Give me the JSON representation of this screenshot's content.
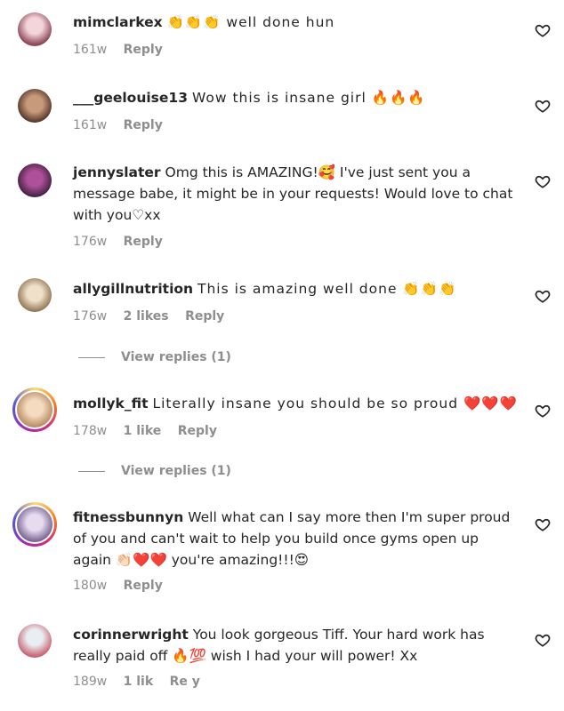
{
  "comments": [
    {
      "username": "mimclarkex",
      "text": "👏👏👏 well done hun",
      "age": "161w",
      "likes": "",
      "reply_label": "Reply",
      "avatar_colors": [
        "#c9a3ae",
        "#8f4a5a"
      ]
    },
    {
      "username": "___geelouise13",
      "text": "Wow this is insane girl 🔥🔥🔥",
      "age": "161w",
      "likes": "",
      "reply_label": "Reply",
      "avatar_colors": [
        "#5a3b2e",
        "#c89a7b"
      ]
    },
    {
      "username": "jennyslater",
      "text": "Omg this is AMAZING!🥰 I've just sent you a message babe, it might be in your requests! Would love to chat with you♡xx",
      "age": "176w",
      "likes": "",
      "reply_label": "Reply",
      "avatar_colors": [
        "#3a1e3a",
        "#b0509a"
      ]
    },
    {
      "username": "allygillnutrition",
      "text": "This is amazing well done 👏👏👏",
      "age": "176w",
      "likes": "2 likes",
      "reply_label": "Reply",
      "view_replies": "View replies (1)",
      "avatar_colors": [
        "#d9c3a6",
        "#8a6e4c"
      ]
    },
    {
      "username": "mollyk_fit",
      "text": "Literally insane you should be so proud ❤️❤️❤️",
      "age": "178w",
      "likes": "1 like",
      "reply_label": "Reply",
      "view_replies": "View replies (1)",
      "avatar_colors": [
        "#e8c9a4",
        "#b3855c"
      ]
    },
    {
      "username": "fitnessbunnyn",
      "text": "Well what can I say more then I'm super proud of you and can't wait to help you build once gyms open up again 👏🏻❤️❤️ you're amazing!!!😍",
      "age": "180w",
      "likes": "",
      "reply_label": "Reply",
      "avatar_colors": [
        "#c7b6d9",
        "#6e5a8a"
      ]
    },
    {
      "username": "corinnerwright",
      "text": "You look gorgeous Tiff. Your hard work has really paid off 🔥💯 wish I had your will power! Xx",
      "age": "189w",
      "likes": "1 lik",
      "reply_label": "Re y",
      "avatar_colors": [
        "#c4d2d9",
        "#c24a5a"
      ]
    }
  ],
  "icons": {
    "like": "heart-outline-icon"
  },
  "colors": {
    "text": "#262626",
    "meta": "#8e8e8e"
  }
}
